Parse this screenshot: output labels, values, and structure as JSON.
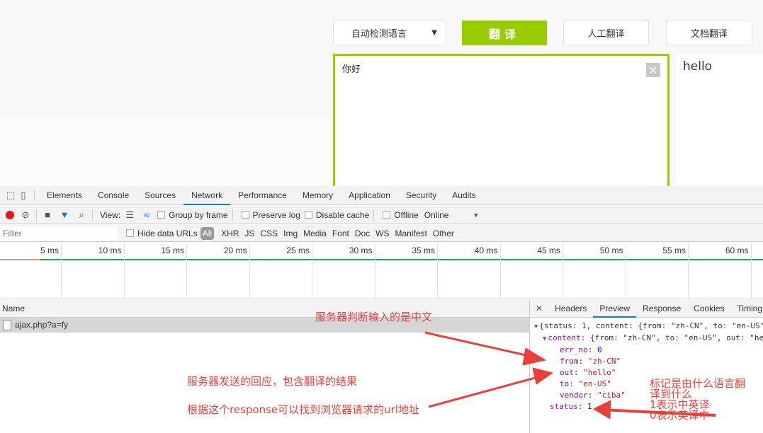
{
  "translator": {
    "lang_select": "自动检测语言",
    "translate_button": "翻译",
    "human_button": "人工翻译",
    "doc_button": "文档翻译",
    "source_text": "你好",
    "output_text": "hello",
    "accent": "#99cc00"
  },
  "devtools": {
    "tabs": [
      "Elements",
      "Console",
      "Sources",
      "Network",
      "Performance",
      "Memory",
      "Application",
      "Security",
      "Audits"
    ],
    "active_tab": "Network",
    "toolbar": {
      "view_label": "View:",
      "group_by_frame": "Group by frame",
      "preserve_log": "Preserve log",
      "disable_cache": "Disable cache",
      "offline": "Offline",
      "throttle": "Online"
    },
    "filter": {
      "placeholder": "Filter",
      "hide_data_urls": "Hide data URLs",
      "types": [
        "All",
        "XHR",
        "JS",
        "CSS",
        "Img",
        "Media",
        "Font",
        "Doc",
        "WS",
        "Manifest",
        "Other"
      ]
    },
    "timeline_ticks": [
      "5 ms",
      "10 ms",
      "15 ms",
      "20 ms",
      "25 ms",
      "30 ms",
      "35 ms",
      "40 ms",
      "45 ms",
      "50 ms",
      "55 ms",
      "60 ms"
    ],
    "list": {
      "header": "Name",
      "rows": [
        "ajax.php?a=fy"
      ]
    },
    "detail_tabs": [
      "Headers",
      "Preview",
      "Response",
      "Cookies",
      "Timing"
    ],
    "active_detail_tab": "Preview",
    "preview": {
      "line1": "{status: 1, content: {from: \"zh-CN\", to: \"en-US\"",
      "line2_key": "content",
      "line2_val": "{from: \"zh-CN\", to: \"en-US\", out: \"he",
      "fields": [
        {
          "key": "err_no",
          "value": "0",
          "type": "num"
        },
        {
          "key": "from",
          "value": "\"zh-CN\"",
          "type": "str"
        },
        {
          "key": "out",
          "value": "\"hello\"",
          "type": "str"
        },
        {
          "key": "to",
          "value": "\"en-US\"",
          "type": "str"
        },
        {
          "key": "vendor",
          "value": "\"ciba\"",
          "type": "str"
        }
      ],
      "status_key": "status",
      "status_val": "1"
    }
  },
  "annotations": {
    "a1": "服务器判断输入的是中文",
    "a2": "服务器发送的回应，包含翻译的结果",
    "a3": "根据这个response可以找到浏览器请求的url地址",
    "a4": [
      "标记是由什么语言翻",
      "译到什么",
      "1表示中英译",
      "0表示英译中"
    ],
    "color": "#e8413c"
  }
}
